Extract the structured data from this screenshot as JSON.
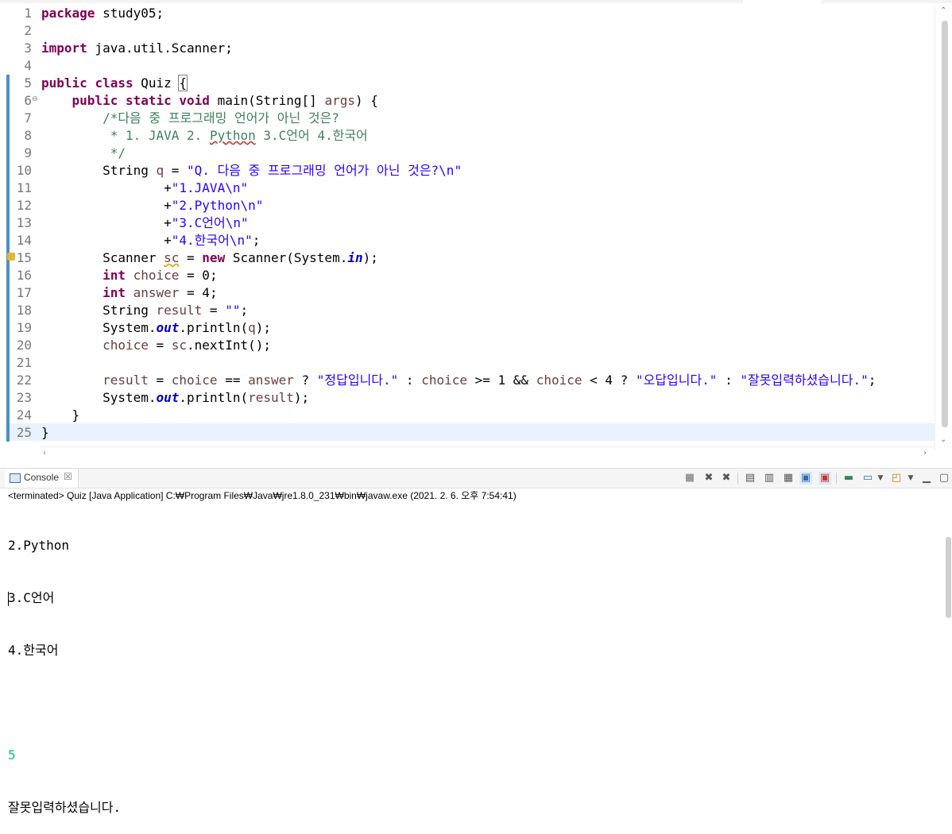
{
  "editor": {
    "line_numbers": [
      "1",
      "2",
      "3",
      "4",
      "5",
      "6",
      "7",
      "8",
      "9",
      "10",
      "11",
      "12",
      "13",
      "14",
      "15",
      "16",
      "17",
      "18",
      "19",
      "20",
      "21",
      "22",
      "23",
      "24",
      "25"
    ],
    "fold_marker": "⊖",
    "l1": {
      "kw": "package",
      "rest": " study05;"
    },
    "l3": {
      "kw": "import",
      "rest": " java.util.Scanner;"
    },
    "l5": {
      "kw1": "public",
      "kw2": "class",
      "name": " Quiz ",
      "brace": "{"
    },
    "l6": {
      "indent": "    ",
      "kw1": "public",
      "kw2": "static",
      "kw3": "void",
      "rest": " main(String[] ",
      "param": "args",
      "end": ") {"
    },
    "l7": {
      "indent": "        ",
      "comment": "/*다음 중 프로그래밍 언어가 아닌 것은?"
    },
    "l8": {
      "indent": "         ",
      "a": "* 1. JAVA 2. ",
      "b": "Python",
      "c": " 3.C언어 4.한국어"
    },
    "l9": {
      "indent": "         ",
      "comment": "*/"
    },
    "l10": {
      "indent": "        ",
      "type": "String ",
      "var": "q",
      "eq": " = ",
      "str": "\"Q. 다음 중 프로그래밍 언어가 아닌 것은?\\n\""
    },
    "l11": {
      "indent": "                ",
      "plus": "+",
      "str": "\"1.JAVA\\n\""
    },
    "l12": {
      "indent": "                ",
      "plus": "+",
      "str": "\"2.Python\\n\""
    },
    "l13": {
      "indent": "                ",
      "plus": "+",
      "str": "\"3.C언어\\n\""
    },
    "l14": {
      "indent": "                ",
      "plus": "+",
      "str": "\"4.한국어\\n\"",
      "end": ";"
    },
    "l15": {
      "indent": "        ",
      "type": "Scanner ",
      "var": "sc",
      "a": " = ",
      "kw": "new",
      "b": " Scanner(System.",
      "fld": "in",
      "c": ");"
    },
    "l16": {
      "indent": "        ",
      "kw": "int",
      "var": " choice",
      "rest": " = 0;"
    },
    "l17": {
      "indent": "        ",
      "kw": "int",
      "var": " answer",
      "rest": " = 4;"
    },
    "l18": {
      "indent": "        ",
      "type": "String ",
      "var": "result",
      "eq": " = ",
      "str": "\"\"",
      "end": ";"
    },
    "l19": {
      "indent": "        ",
      "a": "System.",
      "fld": "out",
      "b": ".println(",
      "var": "q",
      "c": ");"
    },
    "l20": {
      "indent": "        ",
      "var": "choice",
      "a": " = ",
      "var2": "sc",
      "b": ".nextInt();"
    },
    "l22": {
      "indent": "        ",
      "v1": "result",
      "a": " = ",
      "v2": "choice",
      "b": " == ",
      "v3": "answer",
      "c": " ? ",
      "s1": "\"정답입니다.\"",
      "d": " : ",
      "v4": "choice",
      "e": " >= 1 && ",
      "v5": "choice",
      "f": " < 4 ? ",
      "s2": "\"오답입니다.\"",
      "g": " : ",
      "s3": "\"잘못입력하셨습니다.\"",
      "h": ";"
    },
    "l23": {
      "indent": "        ",
      "a": "System.",
      "fld": "out",
      "b": ".println(",
      "var": "result",
      "c": ");"
    },
    "l24": {
      "text": "    }"
    },
    "l25": {
      "text": "}"
    }
  },
  "console": {
    "tab_label": "Console",
    "close_glyph": "☒",
    "status": "<terminated> Quiz [Java Application] C:₩Program Files₩Java₩jre1.8.0_231₩bin₩javaw.exe (2021. 2. 6. 오후 7:54:41)",
    "output_lines": [
      "2.Python",
      "3.C언어",
      "4.한국어",
      ""
    ],
    "input_value": "5",
    "result_line": "잘못입력하셨습니다."
  },
  "toolbar_icons": [
    "terminate-icon",
    "remove-launch-icon",
    "remove-all-terminated-icon",
    "clear-console-icon",
    "scroll-lock-icon",
    "word-wrap-icon",
    "show-on-stdout-icon",
    "show-on-stderr-icon",
    "pin-console-icon",
    "display-selected-console-icon",
    "open-console-icon",
    "minimize-icon",
    "maximize-icon"
  ],
  "colors": {
    "keyword": "#7f0055",
    "string": "#2a00ff",
    "comment": "#3f7f5f",
    "local_variable": "#6a3e3e",
    "static_field": "#0000c0",
    "console_input": "#00c87d",
    "current_line": "#e8f2fe",
    "ruler_mark": "#4a90c8"
  }
}
